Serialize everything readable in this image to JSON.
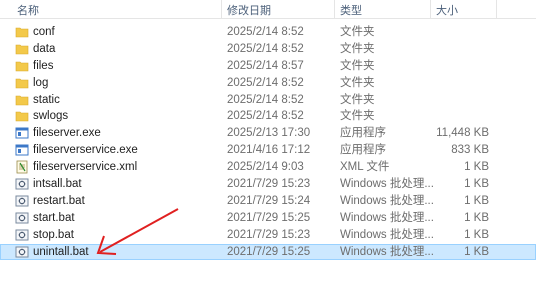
{
  "header": {
    "name_label": "名称",
    "date_label": "修改日期",
    "type_label": "类型",
    "size_label": "大小",
    "sort_caret": "^"
  },
  "files": [
    {
      "name": "conf",
      "date": "2025/2/14 8:52",
      "type": "文件夹",
      "size": "",
      "icon": "folder-icon"
    },
    {
      "name": "data",
      "date": "2025/2/14 8:52",
      "type": "文件夹",
      "size": "",
      "icon": "folder-icon"
    },
    {
      "name": "files",
      "date": "2025/2/14 8:57",
      "type": "文件夹",
      "size": "",
      "icon": "folder-icon"
    },
    {
      "name": "log",
      "date": "2025/2/14 8:52",
      "type": "文件夹",
      "size": "",
      "icon": "folder-icon"
    },
    {
      "name": "static",
      "date": "2025/2/14 8:52",
      "type": "文件夹",
      "size": "",
      "icon": "folder-icon"
    },
    {
      "name": "swlogs",
      "date": "2025/2/14 8:52",
      "type": "文件夹",
      "size": "",
      "icon": "folder-icon"
    },
    {
      "name": "fileserver.exe",
      "date": "2025/2/13 17:30",
      "type": "应用程序",
      "size": "11,448 KB",
      "icon": "exe-icon"
    },
    {
      "name": "fileserverservice.exe",
      "date": "2021/4/16 17:12",
      "type": "应用程序",
      "size": "833 KB",
      "icon": "exe-icon"
    },
    {
      "name": "fileserverservice.xml",
      "date": "2025/2/14 9:03",
      "type": "XML 文件",
      "size": "1 KB",
      "icon": "xml-icon"
    },
    {
      "name": "intsall.bat",
      "date": "2021/7/29 15:23",
      "type": "Windows 批处理...",
      "size": "1 KB",
      "icon": "bat-icon"
    },
    {
      "name": "restart.bat",
      "date": "2021/7/29 15:24",
      "type": "Windows 批处理...",
      "size": "1 KB",
      "icon": "bat-icon"
    },
    {
      "name": "start.bat",
      "date": "2021/7/29 15:25",
      "type": "Windows 批处理...",
      "size": "1 KB",
      "icon": "bat-icon"
    },
    {
      "name": "stop.bat",
      "date": "2021/7/29 15:23",
      "type": "Windows 批处理...",
      "size": "1 KB",
      "icon": "bat-icon"
    },
    {
      "name": "unintall.bat",
      "date": "2021/7/29 15:25",
      "type": "Windows 批处理...",
      "size": "1 KB",
      "icon": "bat-icon",
      "selected": true
    }
  ],
  "colors": {
    "folder": "#f3c94a",
    "selection": "#cce8ff",
    "arrow": "#e02020"
  }
}
